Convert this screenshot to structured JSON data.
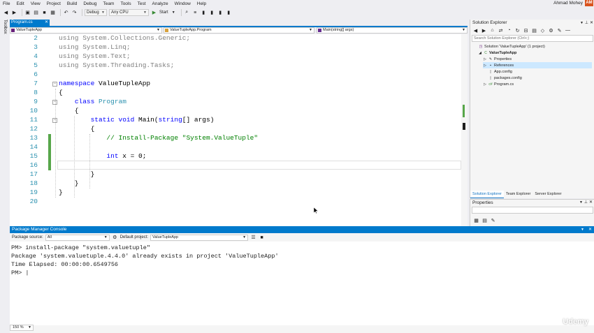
{
  "menu": [
    "File",
    "Edit",
    "View",
    "Project",
    "Build",
    "Debug",
    "Team",
    "Tools",
    "Test",
    "Analyze",
    "Window",
    "Help"
  ],
  "user": {
    "name": "Ahmad Mohey",
    "initials": "AM",
    "avatar_color": "#d9531e"
  },
  "toolbar": {
    "config": "Debug",
    "platform": "Any CPU",
    "start_label": "Start"
  },
  "toolbox_label": "Toolbox",
  "editor": {
    "tab_label": "Program.cs",
    "nav": {
      "project": "ValueTupleApp",
      "class": "ValueTupleApp.Program",
      "member": "Main(string[] args)"
    },
    "lines": [
      {
        "n": "2",
        "html": "<span class=\"gr\">using System.Collections.Generic;</span>"
      },
      {
        "n": "3",
        "html": "<span class=\"gr\">using System.Linq;</span>"
      },
      {
        "n": "4",
        "html": "<span class=\"gr\">using System.Text;</span>"
      },
      {
        "n": "5",
        "html": "<span class=\"gr\">using System.Threading.Tasks;</span>"
      },
      {
        "n": "6",
        "html": ""
      },
      {
        "n": "7",
        "html": "<span class=\"kw\">namespace</span> ValueTupleApp"
      },
      {
        "n": "8",
        "html": "{"
      },
      {
        "n": "9",
        "html": "    <span class=\"kw\">class</span> <span class=\"ty\">Program</span>"
      },
      {
        "n": "10",
        "html": "    {"
      },
      {
        "n": "11",
        "html": "        <span class=\"kw\">static</span> <span class=\"kw\">void</span> Main(<span class=\"kw\">string</span>[] args)"
      },
      {
        "n": "12",
        "html": "        {"
      },
      {
        "n": "13",
        "html": "            <span class=\"cm\">// Install-Package \"System.ValueTuple\"</span>"
      },
      {
        "n": "14",
        "html": ""
      },
      {
        "n": "15",
        "html": "            <span class=\"kw\">int</span> x = 0;"
      },
      {
        "n": "16",
        "html": ""
      },
      {
        "n": "17",
        "html": "        }"
      },
      {
        "n": "18",
        "html": "    }"
      },
      {
        "n": "19",
        "html": "}"
      },
      {
        "n": "20",
        "html": ""
      }
    ]
  },
  "solution_explorer": {
    "title": "Solution Explorer",
    "search_placeholder": "Search Solution Explorer (Ctrl+;)",
    "items": [
      {
        "label": "Solution 'ValueTupleApp' (1 project)",
        "level": 0,
        "icon": "solution-icon",
        "expander": ""
      },
      {
        "label": "ValueTupleApp",
        "level": 1,
        "icon": "csharp-project-icon",
        "expander": "◢",
        "bold": true
      },
      {
        "label": "Properties",
        "level": 2,
        "icon": "wrench-icon",
        "expander": "▷"
      },
      {
        "label": "References",
        "level": 2,
        "icon": "references-icon",
        "expander": "▷",
        "selected": true
      },
      {
        "label": "App.config",
        "level": 2,
        "icon": "config-file-icon",
        "expander": ""
      },
      {
        "label": "packages.config",
        "level": 2,
        "icon": "config-file-icon",
        "expander": ""
      },
      {
        "label": "Program.cs",
        "level": 2,
        "icon": "csharp-file-icon",
        "expander": "▷"
      }
    ],
    "tabs": [
      "Solution Explorer",
      "Team Explorer",
      "Server Explorer"
    ]
  },
  "properties": {
    "title": "Properties"
  },
  "console": {
    "title": "Package Manager Console",
    "source_label": "Package source:",
    "source_value": "All",
    "project_label": "Default project:",
    "project_value": "ValueTupleApp",
    "lines": [
      "PM> install-package \"system.valuetuple\"",
      "Package 'system.valuetuple.4.4.0' already exists in project 'ValueTupleApp'",
      "Time Elapsed: 00:00:00.6549756",
      "PM> |"
    ],
    "zoom": "150 %"
  },
  "watermark": "Udemy",
  "colors": {
    "accent": "#007acc",
    "keyword": "#0000ff",
    "type": "#2b91af",
    "comment": "#008000",
    "change_marker": "#57a64a"
  }
}
